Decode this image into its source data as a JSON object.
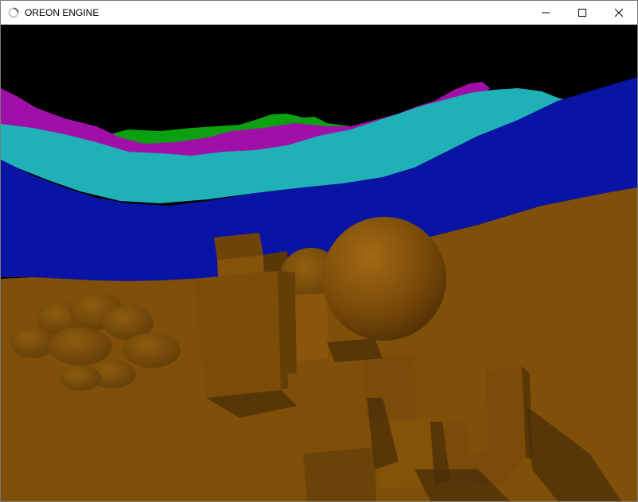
{
  "window": {
    "title": "OREON ENGINE",
    "icon": "loading-ring-icon",
    "controls": {
      "minimize_icon": "minimize-icon",
      "maximize_icon": "maximize-icon",
      "close_icon": "close-icon"
    }
  },
  "scene": {
    "background": "#000000",
    "colors": {
      "green_terrain": "#0aa010",
      "magenta_terrain": "#a010a8",
      "cyan_terrain": "#20b0b8",
      "blue_terrain": "#0a14a4",
      "ground": "#80500a",
      "shadow": "#4a2e08"
    }
  }
}
